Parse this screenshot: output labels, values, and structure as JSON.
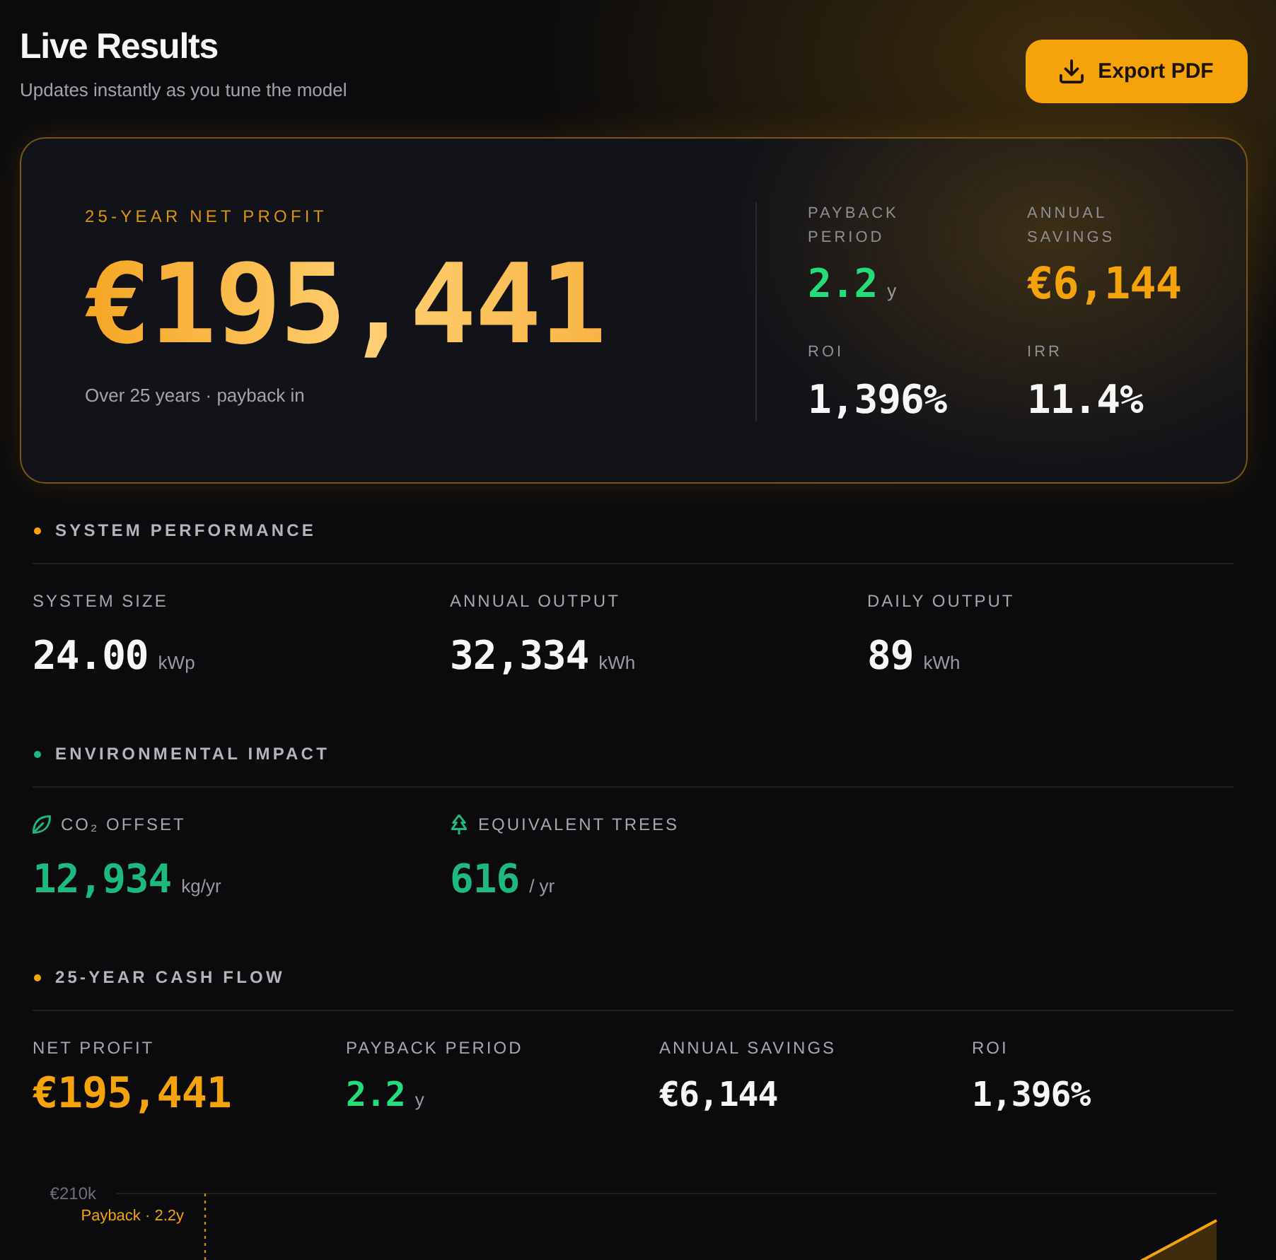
{
  "header": {
    "title": "Live Results",
    "subtitle": "Updates instantly as you tune the model",
    "export_button": "Export PDF"
  },
  "hero": {
    "label": "25-YEAR NET PROFIT",
    "value": "€195,441",
    "caption": "Over 25 years · payback in",
    "stats": [
      {
        "kind": "standard",
        "label": "PAYBACK PERIOD",
        "value": "2.2",
        "unit": "y",
        "color": "#22dd7a"
      },
      {
        "kind": "highlight",
        "label": "ANNUAL SAVINGS",
        "value": "€6,144",
        "color": "#f5a30a"
      },
      {
        "kind": "standard",
        "label": "ROI",
        "value": "1,396%",
        "color": "#f6f6f7"
      },
      {
        "kind": "standard",
        "label": "IRR",
        "value": "11.4%",
        "color": "#f6f6f7"
      }
    ]
  },
  "sections": [
    {
      "kind": "performance",
      "title": "SYSTEM PERFORMANCE",
      "color": "#f5a30a",
      "metrics": [
        {
          "kind": "standard",
          "label": "SYSTEM SIZE",
          "value": "24.00",
          "unit": "kWp",
          "color": "#f6f6f7"
        },
        {
          "kind": "standard",
          "label": "ANNUAL OUTPUT",
          "value": "32,334",
          "unit": "kWh",
          "color": "#f6f6f7"
        },
        {
          "kind": "standard",
          "label": "DAILY OUTPUT",
          "value": "89",
          "unit": "kWh",
          "color": "#f6f6f7"
        }
      ]
    },
    {
      "kind": "environment",
      "title": "ENVIRONMENTAL IMPACT",
      "color": "#1db97d",
      "metrics": [
        {
          "kind": "standard",
          "label": "CO₂ OFFSET",
          "value": "12,934",
          "unit": "kg/yr",
          "color": "#1db97d"
        },
        {
          "kind": "standard",
          "label": "EQUIVALENT TREES",
          "value": "616",
          "unit": "/ yr",
          "color": "#1db97d"
        }
      ]
    },
    {
      "kind": "cashflow",
      "title": "25-YEAR CASH FLOW",
      "color": "#f5a30a",
      "metrics": [
        {
          "kind": "highlight",
          "label": "NET PROFIT",
          "value": "€195,441",
          "color": "#f5a30a"
        },
        {
          "kind": "standard",
          "label": "PAYBACK PERIOD",
          "value": "2.2",
          "unit": "y",
          "color": "#22dd7a"
        },
        {
          "kind": "standard",
          "label": "ANNUAL SAVINGS",
          "value": "€6,144",
          "color": "#f6f6f7"
        },
        {
          "kind": "standard",
          "label": "ROI",
          "value": "1,396%",
          "color": "#f6f6f7"
        }
      ],
      "chart": {
        "tick_label": "€210k",
        "marker_label": "Payback · 2.2y"
      }
    }
  ]
}
